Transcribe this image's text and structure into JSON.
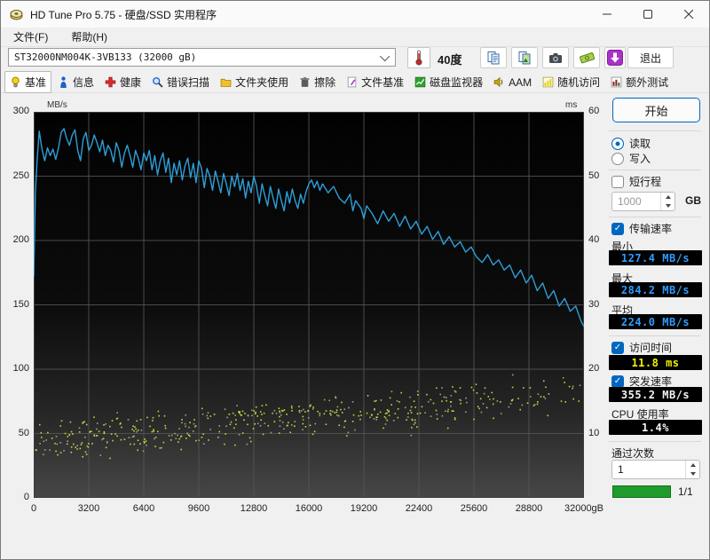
{
  "window": {
    "title": "HD Tune Pro 5.75 - 硬盘/SSD 实用程序"
  },
  "menu": {
    "items": [
      {
        "label": "文件(F)"
      },
      {
        "label": "帮助(H)"
      }
    ]
  },
  "toolbar": {
    "drive_select": "ST32000NM004K-3VB133 (32000 gB)",
    "temperature": "40度",
    "icons": [
      "copy-icon",
      "copy-image-icon",
      "camera-icon",
      "banknote-icon",
      "download-icon"
    ],
    "exit_label": "退出"
  },
  "tabs": [
    {
      "label": "基准",
      "icon": "lightbulb-icon",
      "selected": true
    },
    {
      "label": "信息",
      "icon": "info-icon",
      "selected": false
    },
    {
      "label": "健康",
      "icon": "health-cross-icon",
      "selected": false
    },
    {
      "label": "错误扫描",
      "icon": "magnifier-icon",
      "selected": false
    },
    {
      "label": "文件夹使用",
      "icon": "folder-icon",
      "selected": false
    },
    {
      "label": "擦除",
      "icon": "trash-icon",
      "selected": false
    },
    {
      "label": "文件基准",
      "icon": "file-pen-icon",
      "selected": false
    },
    {
      "label": "磁盘监视器",
      "icon": "monitor-chart-icon",
      "selected": false
    },
    {
      "label": "AAM",
      "icon": "speaker-icon",
      "selected": false
    },
    {
      "label": "随机访问",
      "icon": "random-chart-icon",
      "selected": false
    },
    {
      "label": "额外测试",
      "icon": "extra-chart-icon",
      "selected": false
    }
  ],
  "chart_data": {
    "type": "line",
    "title": "",
    "left_axis": {
      "label": "MB/s",
      "min": 0,
      "max": 300,
      "ticks": [
        300,
        250,
        200,
        150,
        100,
        50,
        0
      ]
    },
    "right_axis": {
      "label": "ms",
      "min": 0,
      "max": 60,
      "ticks": [
        60,
        50,
        40,
        30,
        20,
        10
      ]
    },
    "x_axis": {
      "min": 0,
      "max": 32000,
      "tick_values": [
        0,
        3200,
        6400,
        9600,
        12800,
        16000,
        19200,
        22400,
        25600,
        28800,
        32000
      ],
      "tick_labels": [
        "0",
        "3200",
        "6400",
        "9600",
        "12800",
        "16000",
        "19200",
        "22400",
        "25600",
        "28800",
        "32000gB"
      ]
    },
    "grid": true,
    "series": [
      {
        "name": "transfer-rate",
        "type": "line",
        "axis": "left",
        "color": "#2d9fd8",
        "points": [
          [
            0,
            172
          ],
          [
            100,
            238
          ],
          [
            200,
            263
          ],
          [
            320,
            285
          ],
          [
            480,
            271
          ],
          [
            640,
            262
          ],
          [
            800,
            272
          ],
          [
            960,
            266
          ],
          [
            1120,
            271
          ],
          [
            1280,
            263
          ],
          [
            1440,
            272
          ],
          [
            1600,
            284
          ],
          [
            1760,
            287
          ],
          [
            1920,
            279
          ],
          [
            2080,
            274
          ],
          [
            2240,
            282
          ],
          [
            2400,
            286
          ],
          [
            2560,
            270
          ],
          [
            2720,
            262
          ],
          [
            2880,
            279
          ],
          [
            3040,
            284
          ],
          [
            3200,
            270
          ],
          [
            3360,
            274
          ],
          [
            3520,
            282
          ],
          [
            3680,
            276
          ],
          [
            3840,
            269
          ],
          [
            4000,
            278
          ],
          [
            4160,
            266
          ],
          [
            4320,
            274
          ],
          [
            4480,
            270
          ],
          [
            4640,
            261
          ],
          [
            4800,
            276
          ],
          [
            4960,
            270
          ],
          [
            5120,
            257
          ],
          [
            5280,
            268
          ],
          [
            5440,
            274
          ],
          [
            5600,
            266
          ],
          [
            5760,
            257
          ],
          [
            5920,
            270
          ],
          [
            6080,
            264
          ],
          [
            6240,
            255
          ],
          [
            6400,
            268
          ],
          [
            6560,
            262
          ],
          [
            6720,
            270
          ],
          [
            6880,
            255
          ],
          [
            7040,
            266
          ],
          [
            7200,
            251
          ],
          [
            7360,
            262
          ],
          [
            7520,
            268
          ],
          [
            7680,
            253
          ],
          [
            7840,
            264
          ],
          [
            8000,
            245
          ],
          [
            8160,
            260
          ],
          [
            8320,
            251
          ],
          [
            8480,
            262
          ],
          [
            8640,
            247
          ],
          [
            8800,
            258
          ],
          [
            8960,
            264
          ],
          [
            9120,
            249
          ],
          [
            9280,
            260
          ],
          [
            9440,
            245
          ],
          [
            9600,
            262
          ],
          [
            9760,
            256
          ],
          [
            9920,
            241
          ],
          [
            10080,
            256
          ],
          [
            10240,
            250
          ],
          [
            10400,
            239
          ],
          [
            10560,
            254
          ],
          [
            10720,
            246
          ],
          [
            10880,
            237
          ],
          [
            11040,
            252
          ],
          [
            11200,
            244
          ],
          [
            11360,
            235
          ],
          [
            11520,
            250
          ],
          [
            11680,
            242
          ],
          [
            11840,
            252
          ],
          [
            12000,
            239
          ],
          [
            12160,
            248
          ],
          [
            12320,
            233
          ],
          [
            12480,
            246
          ],
          [
            12640,
            237
          ],
          [
            12800,
            250
          ],
          [
            12960,
            242
          ],
          [
            13120,
            229
          ],
          [
            13280,
            244
          ],
          [
            13440,
            235
          ],
          [
            13600,
            227
          ],
          [
            13760,
            242
          ],
          [
            13920,
            233
          ],
          [
            14080,
            225
          ],
          [
            14240,
            240
          ],
          [
            14400,
            231
          ],
          [
            14560,
            223
          ],
          [
            14720,
            238
          ],
          [
            14880,
            229
          ],
          [
            15040,
            240
          ],
          [
            15200,
            231
          ],
          [
            15360,
            225
          ],
          [
            15520,
            236
          ],
          [
            15680,
            229
          ],
          [
            15840,
            238
          ],
          [
            16000,
            244
          ],
          [
            16160,
            247
          ],
          [
            16320,
            241
          ],
          [
            16480,
            246
          ],
          [
            16640,
            239
          ],
          [
            16800,
            244
          ],
          [
            17120,
            237
          ],
          [
            17440,
            242
          ],
          [
            17760,
            233
          ],
          [
            18080,
            229
          ],
          [
            18400,
            236
          ],
          [
            18560,
            223
          ],
          [
            18720,
            231
          ],
          [
            19040,
            225
          ],
          [
            19200,
            217
          ],
          [
            19360,
            227
          ],
          [
            19680,
            221
          ],
          [
            20000,
            213
          ],
          [
            20320,
            223
          ],
          [
            20640,
            215
          ],
          [
            20960,
            221
          ],
          [
            21280,
            211
          ],
          [
            21600,
            219
          ],
          [
            21920,
            209
          ],
          [
            22240,
            215
          ],
          [
            22560,
            205
          ],
          [
            22880,
            211
          ],
          [
            23200,
            201
          ],
          [
            23520,
            207
          ],
          [
            23840,
            197
          ],
          [
            24160,
            203
          ],
          [
            24480,
            195
          ],
          [
            24800,
            199
          ],
          [
            25120,
            191
          ],
          [
            25440,
            195
          ],
          [
            25760,
            187
          ],
          [
            26080,
            183
          ],
          [
            26400,
            189
          ],
          [
            26720,
            181
          ],
          [
            27040,
            185
          ],
          [
            27360,
            177
          ],
          [
            27680,
            181
          ],
          [
            28000,
            171
          ],
          [
            28320,
            177
          ],
          [
            28640,
            167
          ],
          [
            28960,
            173
          ],
          [
            29280,
            161
          ],
          [
            29600,
            167
          ],
          [
            29920,
            155
          ],
          [
            30240,
            161
          ],
          [
            30560,
            149
          ],
          [
            30880,
            155
          ],
          [
            31200,
            145
          ],
          [
            31520,
            149
          ],
          [
            31840,
            137
          ],
          [
            32000,
            133
          ]
        ]
      },
      {
        "name": "access-time-scatter",
        "type": "scatter",
        "axis": "right",
        "colors": [
          "#d4dd3d",
          "#a8ab84"
        ],
        "generator": {
          "seed": 1337,
          "count": 520,
          "ms_center_start": 9.0,
          "ms_center_end": 16.5,
          "ms_spread": 4.5,
          "sparse_after_gb": 26500,
          "sparse_keep": 0.45
        }
      }
    ]
  },
  "panel": {
    "start_label": "开始",
    "read_label": "读取",
    "write_label": "写入",
    "short_stroke_label": "短行程",
    "capacity_value": "1000",
    "capacity_unit": "GB",
    "transfer_rate_label": "传输速率",
    "min_label": "最小",
    "min_value": "127.4 MB/s",
    "max_label": "最大",
    "max_value": "284.2 MB/s",
    "avg_label": "平均",
    "avg_value": "224.0 MB/s",
    "access_time_label": "访问时间",
    "access_time_value": "11.8 ms",
    "burst_rate_label": "突发速率",
    "burst_rate_value": "355.2 MB/s",
    "cpu_usage_label": "CPU 使用率",
    "cpu_usage_value": "1.4%",
    "pass_count_label": "通过次数",
    "pass_count_value": "1",
    "progress_label": "1/1"
  }
}
